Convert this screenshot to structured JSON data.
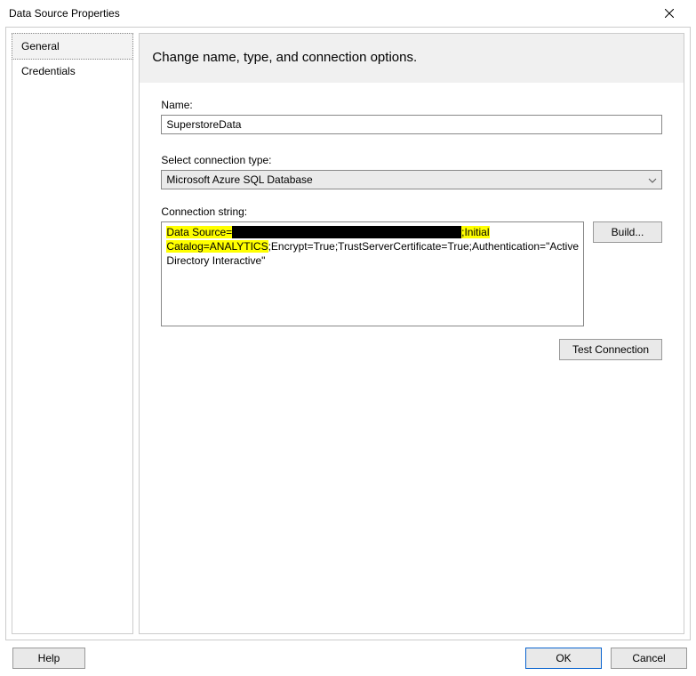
{
  "window": {
    "title": "Data Source Properties"
  },
  "sidebar": {
    "tabs": [
      {
        "label": "General",
        "active": true
      },
      {
        "label": "Credentials",
        "active": false
      }
    ]
  },
  "main": {
    "heading": "Change name, type, and connection options.",
    "name_label": "Name:",
    "name_value": "SuperstoreData",
    "conntype_label": "Select connection type:",
    "conntype_value": "Microsoft Azure SQL Database",
    "connstring_label": "Connection string:",
    "connstring": {
      "seg1": "Data Source=",
      "seg2": ";Initial Catalog=ANALYTICS",
      "seg3": ";Encrypt=True;TrustServerCertificate=True;Authentication=\"Active Directory Interactive\""
    },
    "build_label": "Build...",
    "test_label": "Test Connection"
  },
  "footer": {
    "help_label": "Help",
    "ok_label": "OK",
    "cancel_label": "Cancel"
  }
}
